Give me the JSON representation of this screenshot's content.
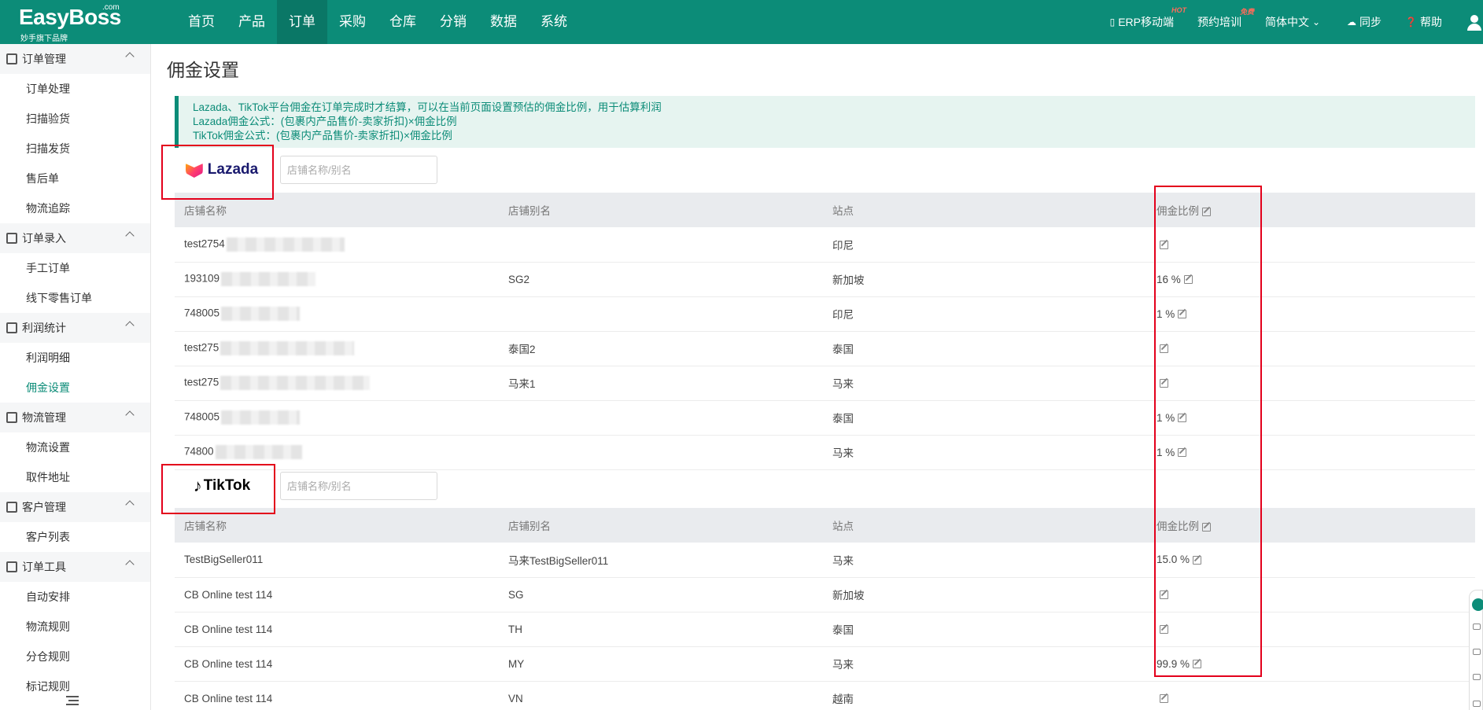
{
  "brand": {
    "name": "EasyBoss",
    "com": ".com",
    "tagline": "妙手旗下品牌"
  },
  "nav": [
    "首页",
    "产品",
    "订单",
    "采购",
    "仓库",
    "分销",
    "数据",
    "系统"
  ],
  "nav_active": "订单",
  "top_right": {
    "erp": "ERP移动端",
    "erp_badge": "HOT",
    "training": "预约培训",
    "training_badge": "免费",
    "language": "简体中文",
    "sync": "同步",
    "help": "帮助"
  },
  "sidebar": {
    "groups": [
      {
        "title": "订单管理",
        "items": [
          "订单处理",
          "扫描验货",
          "扫描发货",
          "售后单",
          "物流追踪"
        ]
      },
      {
        "title": "订单录入",
        "items": [
          "手工订单",
          "线下零售订单"
        ]
      },
      {
        "title": "利润统计",
        "items": [
          "利润明细",
          "佣金设置"
        ]
      },
      {
        "title": "物流管理",
        "items": [
          "物流设置",
          "取件地址"
        ]
      },
      {
        "title": "客户管理",
        "items": [
          "客户列表"
        ]
      },
      {
        "title": "订单工具",
        "items": [
          "自动安排",
          "物流规则",
          "分仓规则",
          "标记规则"
        ]
      }
    ],
    "active_item": "佣金设置"
  },
  "page": {
    "title": "佣金设置",
    "notice": [
      "Lazada、TikTok平台佣金在订单完成时才结算，可以在当前页面设置预估的佣金比例，用于估算利润",
      "Lazada佣金公式：(包裹内产品售价-卖家折扣)×佣金比例",
      "TikTok佣金公式：(包裹内产品售价-卖家折扣)×佣金比例"
    ],
    "search_placeholder": "店铺名称/别名",
    "columns": [
      "店铺名称",
      "店铺别名",
      "站点",
      "佣金比例"
    ]
  },
  "lazada": {
    "logo_text": "Lazada",
    "rows": [
      {
        "name": "test2754",
        "alias": "",
        "site": "印尼",
        "rate": ""
      },
      {
        "name": "193109",
        "alias": "SG2",
        "site": "新加坡",
        "rate": "16 %"
      },
      {
        "name": "748005",
        "alias": "",
        "site": "印尼",
        "rate": "1 %"
      },
      {
        "name": "test275",
        "alias": "泰国2",
        "site": "泰国",
        "rate": ""
      },
      {
        "name": "test275",
        "alias": "马来1",
        "site": "马来",
        "rate": ""
      },
      {
        "name": "748005",
        "alias": "",
        "site": "泰国",
        "rate": "1 %"
      },
      {
        "name": "74800",
        "alias": "",
        "site": "马来",
        "rate": "1 %"
      }
    ]
  },
  "tiktok": {
    "logo_text": "TikTok",
    "rows": [
      {
        "name": "TestBigSeller011",
        "alias": "马来TestBigSeller011",
        "site": "马来",
        "rate": "15.0 %"
      },
      {
        "name": "CB Online test 114",
        "alias": "SG",
        "site": "新加坡",
        "rate": ""
      },
      {
        "name": "CB Online test 114",
        "alias": "TH",
        "site": "泰国",
        "rate": ""
      },
      {
        "name": "CB Online test 114",
        "alias": "MY",
        "site": "马来",
        "rate": "99.9 %"
      },
      {
        "name": "CB Online test 114",
        "alias": "VN",
        "site": "越南",
        "rate": ""
      }
    ]
  },
  "colors": {
    "primary": "#0c8c78",
    "highlight": "#e3001b"
  }
}
